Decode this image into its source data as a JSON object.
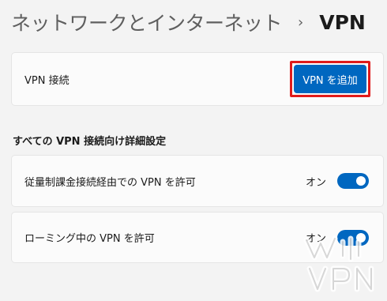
{
  "breadcrumb": {
    "parent": "ネットワークとインターネット",
    "separator": "›",
    "current": "VPN"
  },
  "vpn_connections": {
    "label": "VPN 接続",
    "add_button": "VPN を追加"
  },
  "advanced": {
    "title": "すべての VPN 接続向け詳細設定",
    "metered": {
      "label": "従量制課金接続経由での VPN を許可",
      "state": "オン",
      "on": true
    },
    "roaming": {
      "label": "ローミング中の VPN を許可",
      "state": "オン",
      "on": true
    }
  },
  "colors": {
    "accent": "#0067c0",
    "highlight": "#e11b1b"
  }
}
